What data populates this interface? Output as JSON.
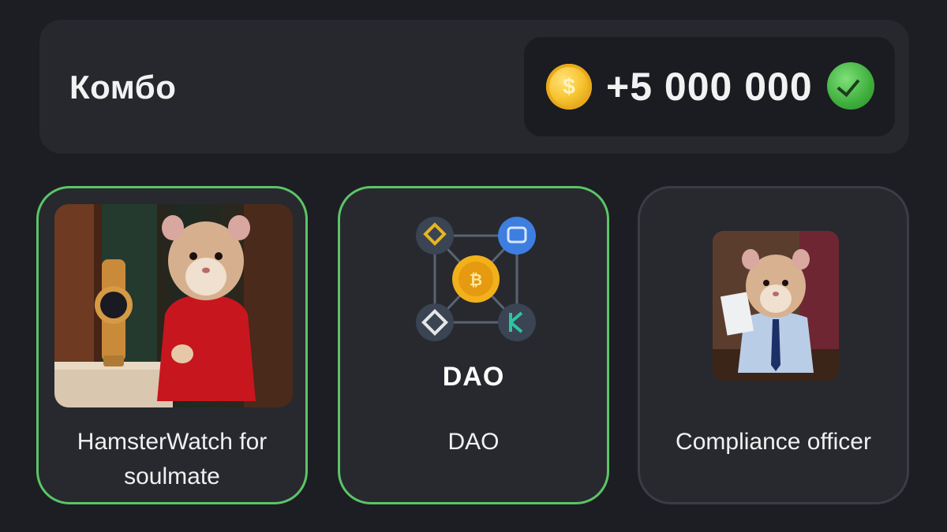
{
  "combo": {
    "title": "Комбо",
    "reward": "+5 000 000",
    "coin_symbol": "$",
    "status_icon": "check-circle-icon"
  },
  "cards": [
    {
      "label": "HamsterWatch for soulmate",
      "image": "hamster-with-gold-watch",
      "selected": true
    },
    {
      "label": "DAO",
      "image_text": "DAO",
      "image": "dao-crypto-network",
      "selected": true
    },
    {
      "label": "Compliance officer",
      "image": "hamster-in-office",
      "selected": false
    }
  ],
  "colors": {
    "background": "#1c1e23",
    "panel": "#26282e",
    "card": "#27292f",
    "accent_green": "#5cc466",
    "coin_gold": "#f7c531"
  }
}
